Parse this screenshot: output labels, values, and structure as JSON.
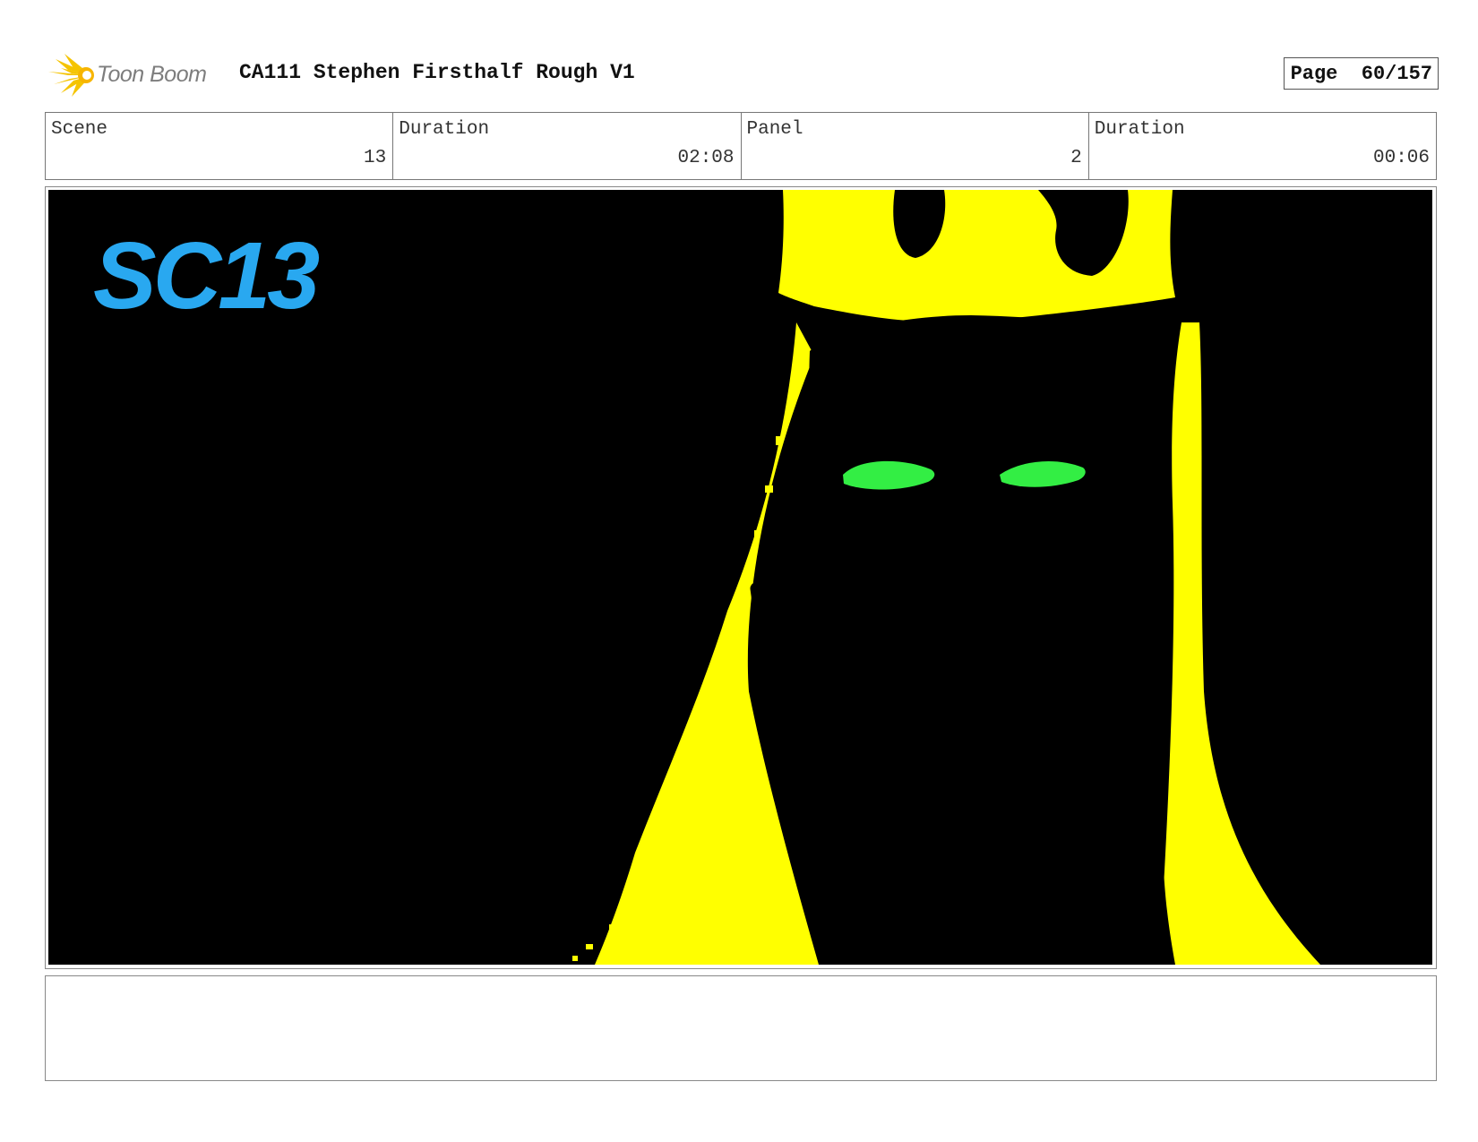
{
  "header": {
    "logo_text": "Toon Boom",
    "title": "CA111 Stephen Firsthalf Rough V1",
    "page_label": "Page",
    "page_number": "60/157"
  },
  "info": {
    "scene": {
      "label": "Scene",
      "value": "13"
    },
    "scene_duration": {
      "label": "Duration",
      "value": "02:08"
    },
    "panel": {
      "label": "Panel",
      "value": "2"
    },
    "panel_duration": {
      "label": "Duration",
      "value": "00:06"
    }
  },
  "drawing": {
    "annotation": "SC13",
    "colors": {
      "background": "#000000",
      "figure": "#ffff00",
      "eyes": "#33ee44",
      "annotation": "#29a8f0"
    }
  },
  "caption": {
    "text": ""
  }
}
